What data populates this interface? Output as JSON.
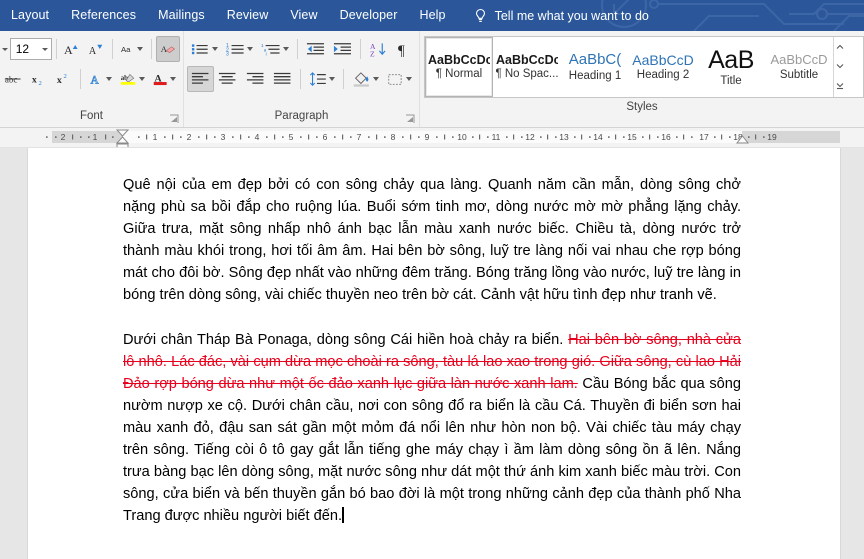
{
  "ribbon": {
    "tabs": [
      {
        "label": "Layout",
        "active": false
      },
      {
        "label": "References",
        "active": false
      },
      {
        "label": "Mailings",
        "active": false
      },
      {
        "label": "Review",
        "active": false
      },
      {
        "label": "View",
        "active": false
      },
      {
        "label": "Developer",
        "active": false
      },
      {
        "label": "Help",
        "active": false
      }
    ],
    "tellme": {
      "icon": "lightbulb-icon",
      "placeholder": "Tell me what you want to do"
    },
    "accent_color": "#2b579a",
    "groups": {
      "font": {
        "label": "Font",
        "size_value": "12",
        "buttons": [
          {
            "name": "font-name-dropdown-arrow",
            "glyph": "▾"
          },
          {
            "name": "grow-font",
            "glyph": "A"
          },
          {
            "name": "shrink-font",
            "glyph": "A"
          },
          {
            "name": "change-case",
            "glyph": "Aa"
          },
          {
            "name": "clear-formatting",
            "glyph": "A"
          },
          {
            "name": "strikethrough",
            "glyph": "abc"
          },
          {
            "name": "subscript",
            "glyph": "x₂"
          },
          {
            "name": "superscript",
            "glyph": "x²"
          },
          {
            "name": "text-effects",
            "glyph": "A"
          },
          {
            "name": "text-highlight-color",
            "glyph": "ab"
          },
          {
            "name": "font-color",
            "glyph": "A"
          }
        ]
      },
      "paragraph": {
        "label": "Paragraph",
        "buttons": [
          {
            "name": "bullets"
          },
          {
            "name": "numbering"
          },
          {
            "name": "multilevel-list"
          },
          {
            "name": "decrease-indent"
          },
          {
            "name": "increase-indent"
          },
          {
            "name": "sort"
          },
          {
            "name": "show-formatting-marks",
            "glyph": "¶"
          },
          {
            "name": "align-left",
            "active": true
          },
          {
            "name": "align-center"
          },
          {
            "name": "align-right"
          },
          {
            "name": "justify"
          },
          {
            "name": "line-spacing"
          },
          {
            "name": "shading"
          },
          {
            "name": "borders"
          }
        ]
      },
      "styles": {
        "label": "Styles",
        "items": [
          {
            "preview": "AaBbCcDc",
            "name": "¶ Normal",
            "active": true,
            "variant": "normal"
          },
          {
            "preview": "AaBbCcDc",
            "name": "¶ No Spac...",
            "active": false,
            "variant": "nospace"
          },
          {
            "preview": "AaBbC(",
            "name": "Heading 1",
            "active": false,
            "variant": "h1"
          },
          {
            "preview": "AaBbCcD",
            "name": "Heading 2",
            "active": false,
            "variant": "h2"
          },
          {
            "preview": "AaB",
            "name": "Title",
            "active": false,
            "variant": "title"
          },
          {
            "preview": "AaBbCcD",
            "name": "Subtitle",
            "active": false,
            "variant": "subtitle"
          }
        ]
      }
    }
  },
  "ruler": {
    "left_labels": [
      "2",
      "1"
    ],
    "right_labels": [
      "1",
      "2",
      "3",
      "4",
      "5",
      "6",
      "7",
      "8",
      "9",
      "10",
      "11",
      "12",
      "13",
      "14",
      "15",
      "16",
      "17",
      "18",
      "19"
    ],
    "left_indent_marker": "hourglass-indent-marker",
    "right_indent_marker": "right-indent-marker"
  },
  "document": {
    "paragraph1": "Quê nội của em đẹp bởi có con sông chảy qua làng. Quanh năm cần mẫn, dòng sông chở nặng phù sa bồi đắp cho ruộng lúa. Buổi sớm tinh mơ, dòng nước mờ mờ phẳng lặng chảy. Giữa trưa, mặt sông nhấp nhô ánh bạc lẫn màu xanh nước biếc. Chiều tà, dòng nước trở thành màu khói trong, hơi tối âm âm. Hai bên bờ sông, luỹ tre làng nối vai nhau che rợp bóng mát cho đôi bờ. Sông đẹp nhất vào những đêm trăng. Bóng trăng lồng vào nước, luỹ tre làng in bóng trên dòng sông, vài chiếc thuyền neo trên bờ cát. Cảnh vật hữu tình đẹp như tranh vẽ.",
    "paragraph2_before": "Dưới chân Tháp Bà Ponaga, dòng sông Cái hiền hoà chảy ra biển. ",
    "paragraph2_deleted": "Hai bên bờ sông, nhà cửa lô nhô. Lác đác, vài cụm dừa mọc choài ra sông, tàu lá lao xao trong gió. Giữa sông, cù lao Hải Đảo rợp bóng dừa như một ốc đảo xanh lục giữa làn nước xanh lam.",
    "paragraph2_after": " Cầu Bóng bắc qua sông nườm nượp xe cộ. Dưới chân cầu, nơi con sông đổ ra biển là cầu Cá. Thuyền đi biển sơn hai màu xanh đỏ, đậu san sát gần một mỏm đá nổi lên như hòn non bộ. Vài chiếc tàu máy chạy trên sông. Tiếng còi ô tô gay gắt lẫn tiếng ghe máy chạy ì ầm làm dòng sông ồn ã lên. Nắng trưa bàng bạc lên dòng sông, mặt nước sông như dát một thứ ánh kim xanh biếc màu trời. Con sông, cửa biển và bến thuyền gắn bó bao đời là một trong những cảnh đẹp của thành phố Nha Trang được nhiều người biết đến.",
    "deleted_text_color": "#e8001c"
  }
}
